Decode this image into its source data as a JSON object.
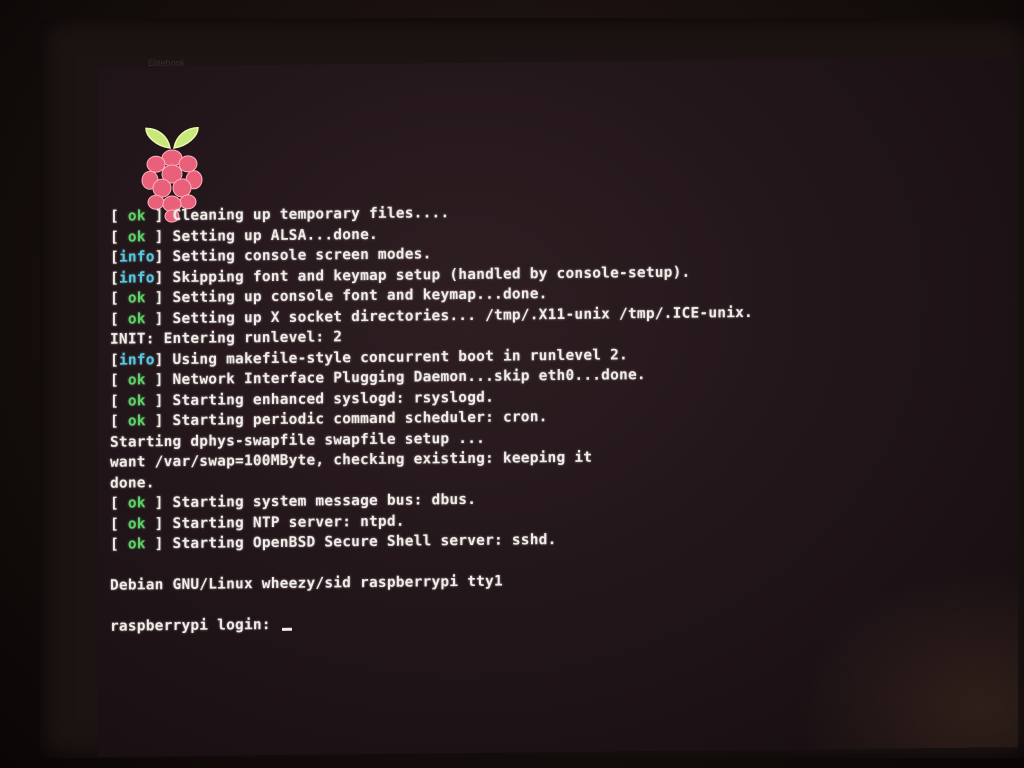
{
  "monitor": {
    "brand": "Elitebook"
  },
  "logo": {
    "icon": "raspberry-pi-logo",
    "leaf_color": "#c8e87a",
    "berry_color": "#e8607a"
  },
  "console": {
    "lines": [
      {
        "status": "ok",
        "text": "Cleaning up temporary files...."
      },
      {
        "status": "ok",
        "text": "Setting up ALSA...done."
      },
      {
        "status": "info",
        "text": "Setting console screen modes."
      },
      {
        "status": "info",
        "text": "Skipping font and keymap setup (handled by console-setup)."
      },
      {
        "status": "ok",
        "text": "Setting up console font and keymap...done."
      },
      {
        "status": "ok",
        "text": "Setting up X socket directories... /tmp/.X11-unix /tmp/.ICE-unix."
      },
      {
        "status": "",
        "text": "INIT: Entering runlevel: 2"
      },
      {
        "status": "info",
        "text": "Using makefile-style concurrent boot in runlevel 2."
      },
      {
        "status": "ok",
        "text": "Network Interface Plugging Daemon...skip eth0...done."
      },
      {
        "status": "ok",
        "text": "Starting enhanced syslogd: rsyslogd."
      },
      {
        "status": "ok",
        "text": "Starting periodic command scheduler: cron."
      },
      {
        "status": "",
        "text": "Starting dphys-swapfile swapfile setup ..."
      },
      {
        "status": "",
        "text": "want /var/swap=100MByte, checking existing: keeping it"
      },
      {
        "status": "",
        "text": "done."
      },
      {
        "status": "ok",
        "text": "Starting system message bus: dbus."
      },
      {
        "status": "ok",
        "text": "Starting NTP server: ntpd."
      },
      {
        "status": "ok",
        "text": "Starting OpenBSD Secure Shell server: sshd."
      }
    ],
    "banner": "Debian GNU/Linux wheezy/sid raspberrypi tty1",
    "login_prompt": "raspberrypi login:",
    "login_value": ""
  },
  "status_labels": {
    "ok": " ok ",
    "info": "info"
  },
  "colors": {
    "ok": "#5fd06a",
    "info": "#58c8e0",
    "text": "#f2ece8"
  }
}
